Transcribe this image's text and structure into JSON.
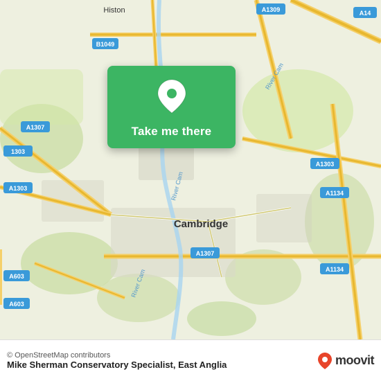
{
  "map": {
    "attribution": "© OpenStreetMap contributors"
  },
  "card": {
    "button_label": "Take me there",
    "pin_icon": "location-pin-icon"
  },
  "footer": {
    "copyright": "© OpenStreetMap contributors",
    "business_name": "Mike Sherman Conservatory Specialist, East Anglia",
    "moovit_label": "moovit"
  }
}
